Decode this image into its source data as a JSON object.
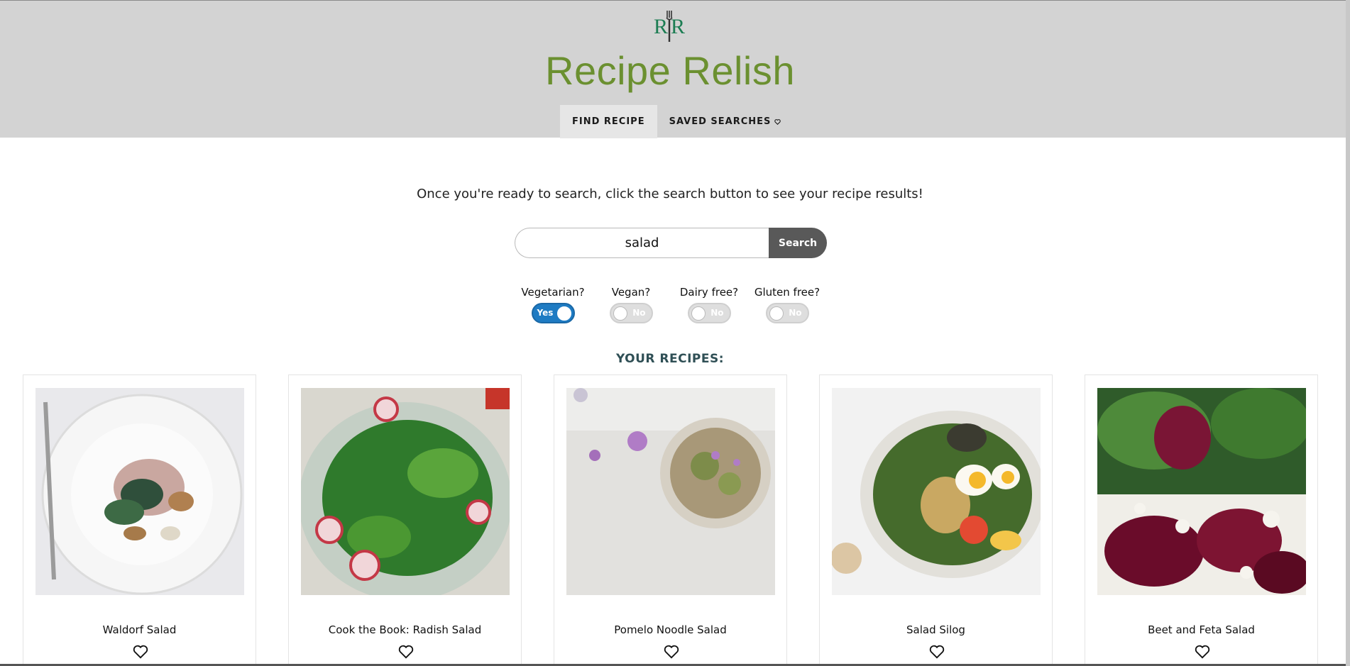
{
  "header": {
    "logo_text": "RR",
    "title": "Recipe Relish",
    "nav": [
      {
        "label": "FIND RECIPE",
        "active": true
      },
      {
        "label": "SAVED SEARCHES",
        "icon": "heart-outline-icon",
        "active": false
      }
    ],
    "colors": {
      "title": "#6b9030",
      "logo": "#1c7d53",
      "header_bg": "#d3d3d3"
    }
  },
  "main": {
    "instruction": "Once you're ready to search, click the search button to see your recipe results!",
    "search": {
      "value": "salad",
      "placeholder": "",
      "button_label": "Search"
    },
    "filters": [
      {
        "label": "Vegetarian?",
        "state": "Yes"
      },
      {
        "label": "Vegan?",
        "state": "No"
      },
      {
        "label": "Dairy free?",
        "state": "No"
      },
      {
        "label": "Gluten free?",
        "state": "No"
      }
    ],
    "results_heading": "YOUR RECIPES:",
    "recipes": [
      {
        "title": "Waldorf Salad",
        "icon": "heart-outline-icon"
      },
      {
        "title": "Cook the Book: Radish Salad",
        "icon": "heart-outline-icon"
      },
      {
        "title": "Pomelo Noodle Salad",
        "icon": "heart-outline-icon"
      },
      {
        "title": "Salad Silog",
        "icon": "heart-outline-icon"
      },
      {
        "title": "Beet and Feta Salad",
        "icon": "heart-outline-icon"
      }
    ]
  }
}
